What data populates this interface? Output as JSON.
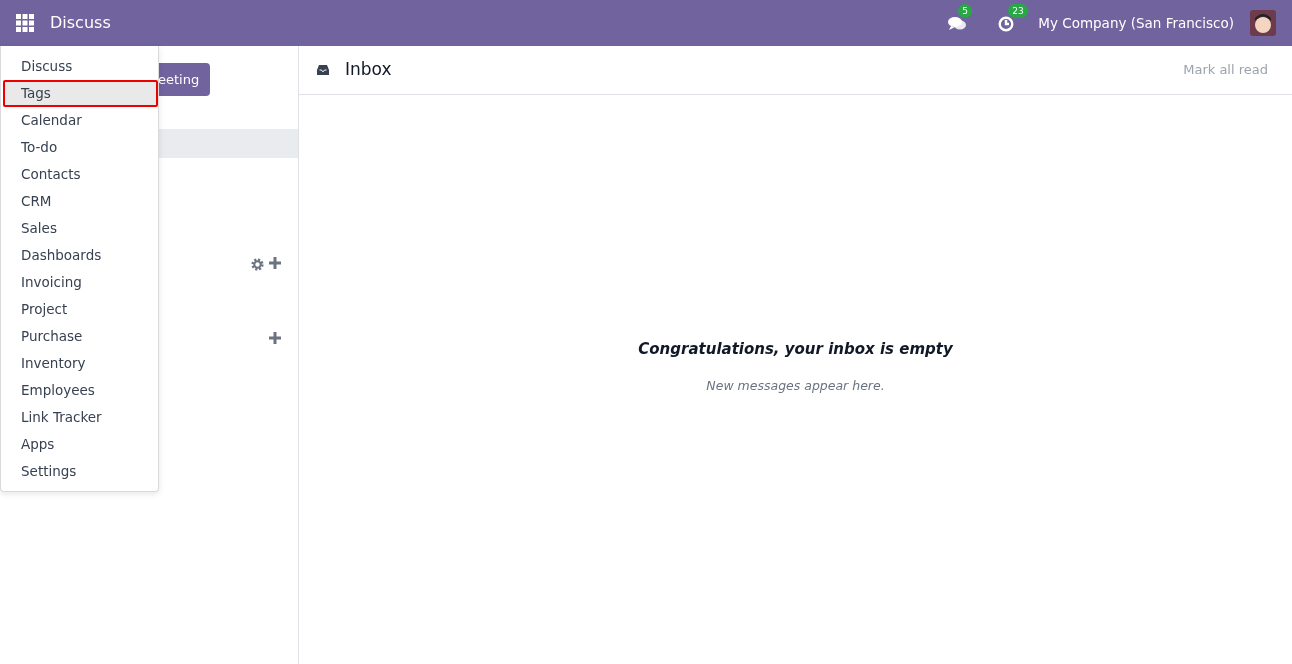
{
  "navbar": {
    "app_title": "Discuss",
    "messages_count": "5",
    "activities_count": "23",
    "company": "My Company (San Francisco)"
  },
  "sidebar": {
    "meeting_button": "eeting"
  },
  "app_menu": {
    "items": [
      {
        "label": "Discuss",
        "selected": false
      },
      {
        "label": "Tags",
        "selected": true
      },
      {
        "label": "Calendar",
        "selected": false
      },
      {
        "label": "To-do",
        "selected": false
      },
      {
        "label": "Contacts",
        "selected": false
      },
      {
        "label": "CRM",
        "selected": false
      },
      {
        "label": "Sales",
        "selected": false
      },
      {
        "label": "Dashboards",
        "selected": false
      },
      {
        "label": "Invoicing",
        "selected": false
      },
      {
        "label": "Project",
        "selected": false
      },
      {
        "label": "Purchase",
        "selected": false
      },
      {
        "label": "Inventory",
        "selected": false
      },
      {
        "label": "Employees",
        "selected": false
      },
      {
        "label": "Link Tracker",
        "selected": false
      },
      {
        "label": "Apps",
        "selected": false
      },
      {
        "label": "Settings",
        "selected": false
      }
    ]
  },
  "inbox": {
    "title": "Inbox",
    "mark_all_read": "Mark all read",
    "empty_title": "Congratulations, your inbox is empty",
    "empty_hint": "New messages appear here."
  }
}
